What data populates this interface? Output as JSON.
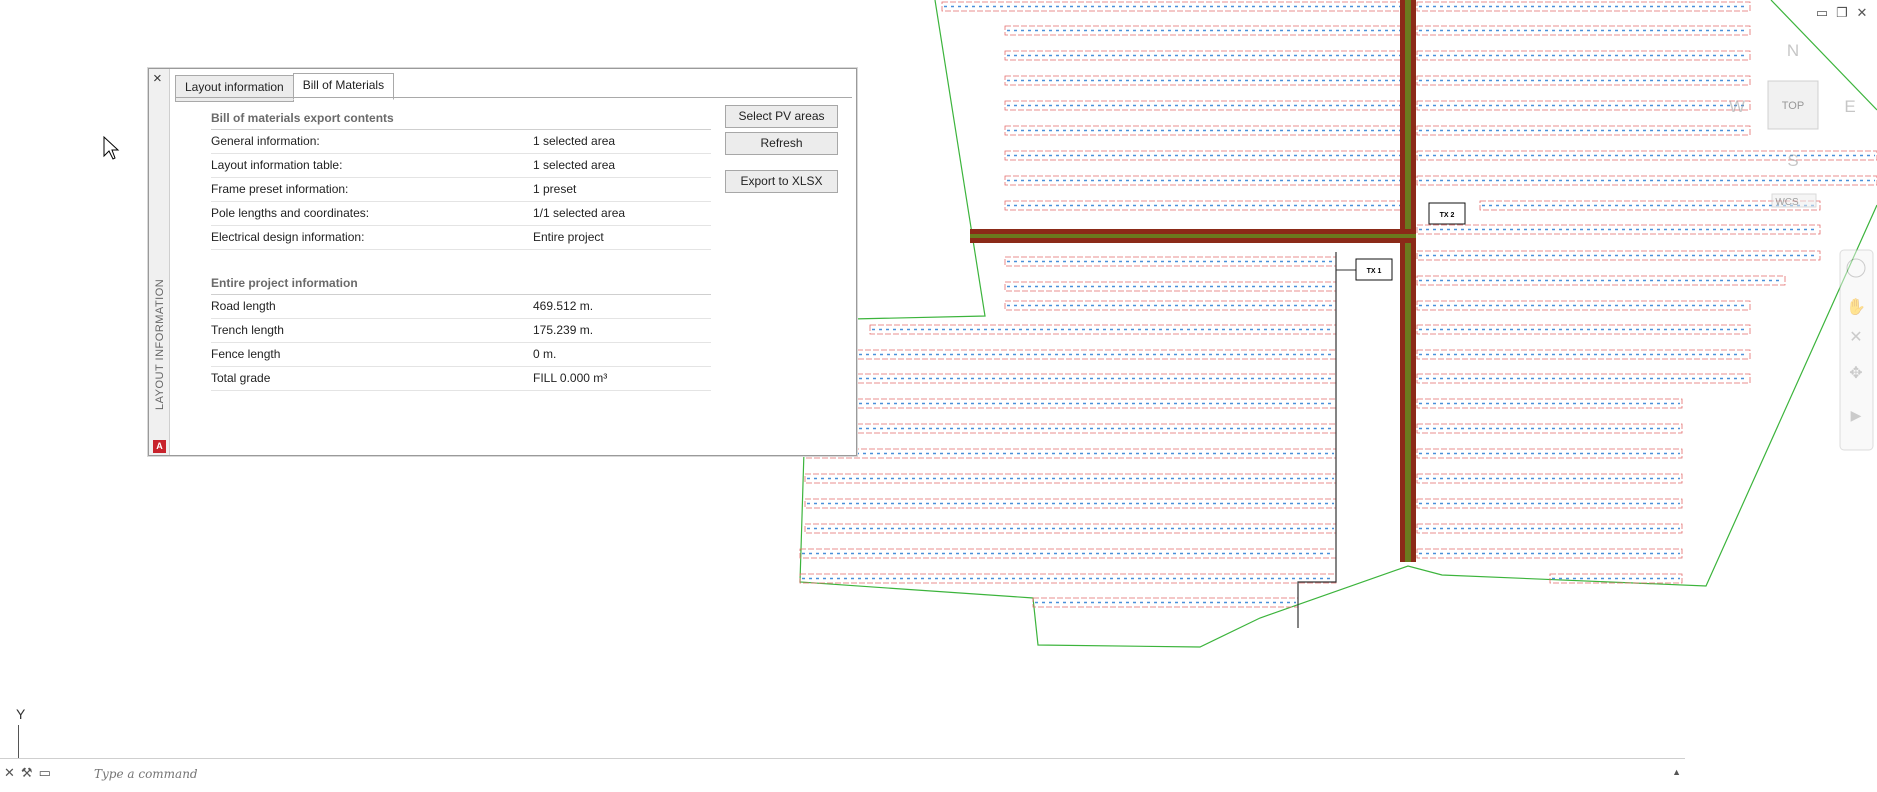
{
  "window_controls": [
    "minimize",
    "restore",
    "close"
  ],
  "viewcube": {
    "north": "N",
    "south": "S",
    "east": "E",
    "west": "W",
    "face": "TOP",
    "wcs": "WCS"
  },
  "drawing": {
    "transformer_1": "TX 1",
    "transformer_2": "TX 2"
  },
  "palette": {
    "vertical_title": "LAYOUT INFORMATION",
    "tabs": [
      {
        "label": "Layout information"
      },
      {
        "label": "Bill of Materials"
      }
    ],
    "active_tab": "Bill of Materials",
    "export_section": {
      "title": "Bill of materials export contents",
      "rows": [
        {
          "key": "General information:",
          "value": "1 selected area"
        },
        {
          "key": "Layout information table:",
          "value": "1 selected area"
        },
        {
          "key": "Frame preset information:",
          "value": "1 preset"
        },
        {
          "key": "Pole lengths and coordinates:",
          "value": "1/1 selected area"
        },
        {
          "key": "Electrical design information:",
          "value": "Entire project"
        }
      ]
    },
    "project_section": {
      "title": "Entire project information",
      "rows": [
        {
          "key": "Road length",
          "value": "469.512 m."
        },
        {
          "key": "Trench length",
          "value": "175.239 m."
        },
        {
          "key": "Fence length",
          "value": "0 m."
        },
        {
          "key": "Total grade",
          "value": "FILL 0.000 m³"
        }
      ]
    },
    "buttons": {
      "select": "Select PV areas",
      "refresh": "Refresh",
      "export": "Export to XLSX"
    }
  },
  "command_line": {
    "placeholder": "Type a command"
  },
  "ucs_label": "Y",
  "colors": {
    "fence": "#3cb43c",
    "road": "#8b2a18",
    "road_core": "#6a7a1e",
    "pv_row": "#e46b6b",
    "pv_cells": "#4a90d9"
  }
}
